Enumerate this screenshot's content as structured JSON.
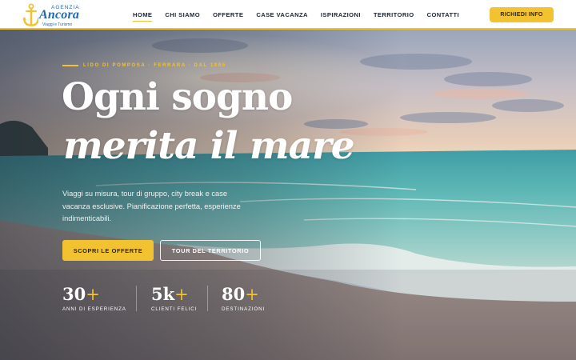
{
  "brand": {
    "agenzia": "AGENZIA",
    "name": "Ancora",
    "tagline": "Viaggi e Turismo"
  },
  "nav": {
    "items": [
      {
        "label": "HOME",
        "active": true
      },
      {
        "label": "CHI SIAMO"
      },
      {
        "label": "OFFERTE"
      },
      {
        "label": "CASE VACANZA"
      },
      {
        "label": "ISPIRAZIONI"
      },
      {
        "label": "TERRITORIO"
      },
      {
        "label": "CONTATTI"
      }
    ],
    "cta": "RICHIEDI INFO"
  },
  "hero": {
    "eyebrow": "LIDO DI POMPOSA · FERRARA · DAL 1995",
    "title_line1": "Ogni sogno",
    "title_line2": "merita il mare",
    "description": "Viaggi su misura, tour di gruppo, city break e case vacanza esclusive. Pianificazione perfetta, esperienze indimenticabili.",
    "primary_button": "SCOPRI LE OFFERTE",
    "secondary_button": "TOUR DEL TERRITORIO",
    "stats": [
      {
        "value": "30",
        "suffix": "+",
        "label": "ANNI DI ESPERIENZA"
      },
      {
        "value": "5k",
        "suffix": "+",
        "label": "CLIENTI FELICI"
      },
      {
        "value": "80",
        "suffix": "+",
        "label": "DESTINAZIONI"
      }
    ]
  },
  "colors": {
    "accent": "#f2c230",
    "brand_blue": "#1f66b4",
    "text_dark": "#1d2630"
  },
  "icons": {
    "logo": "anchor-icon"
  }
}
